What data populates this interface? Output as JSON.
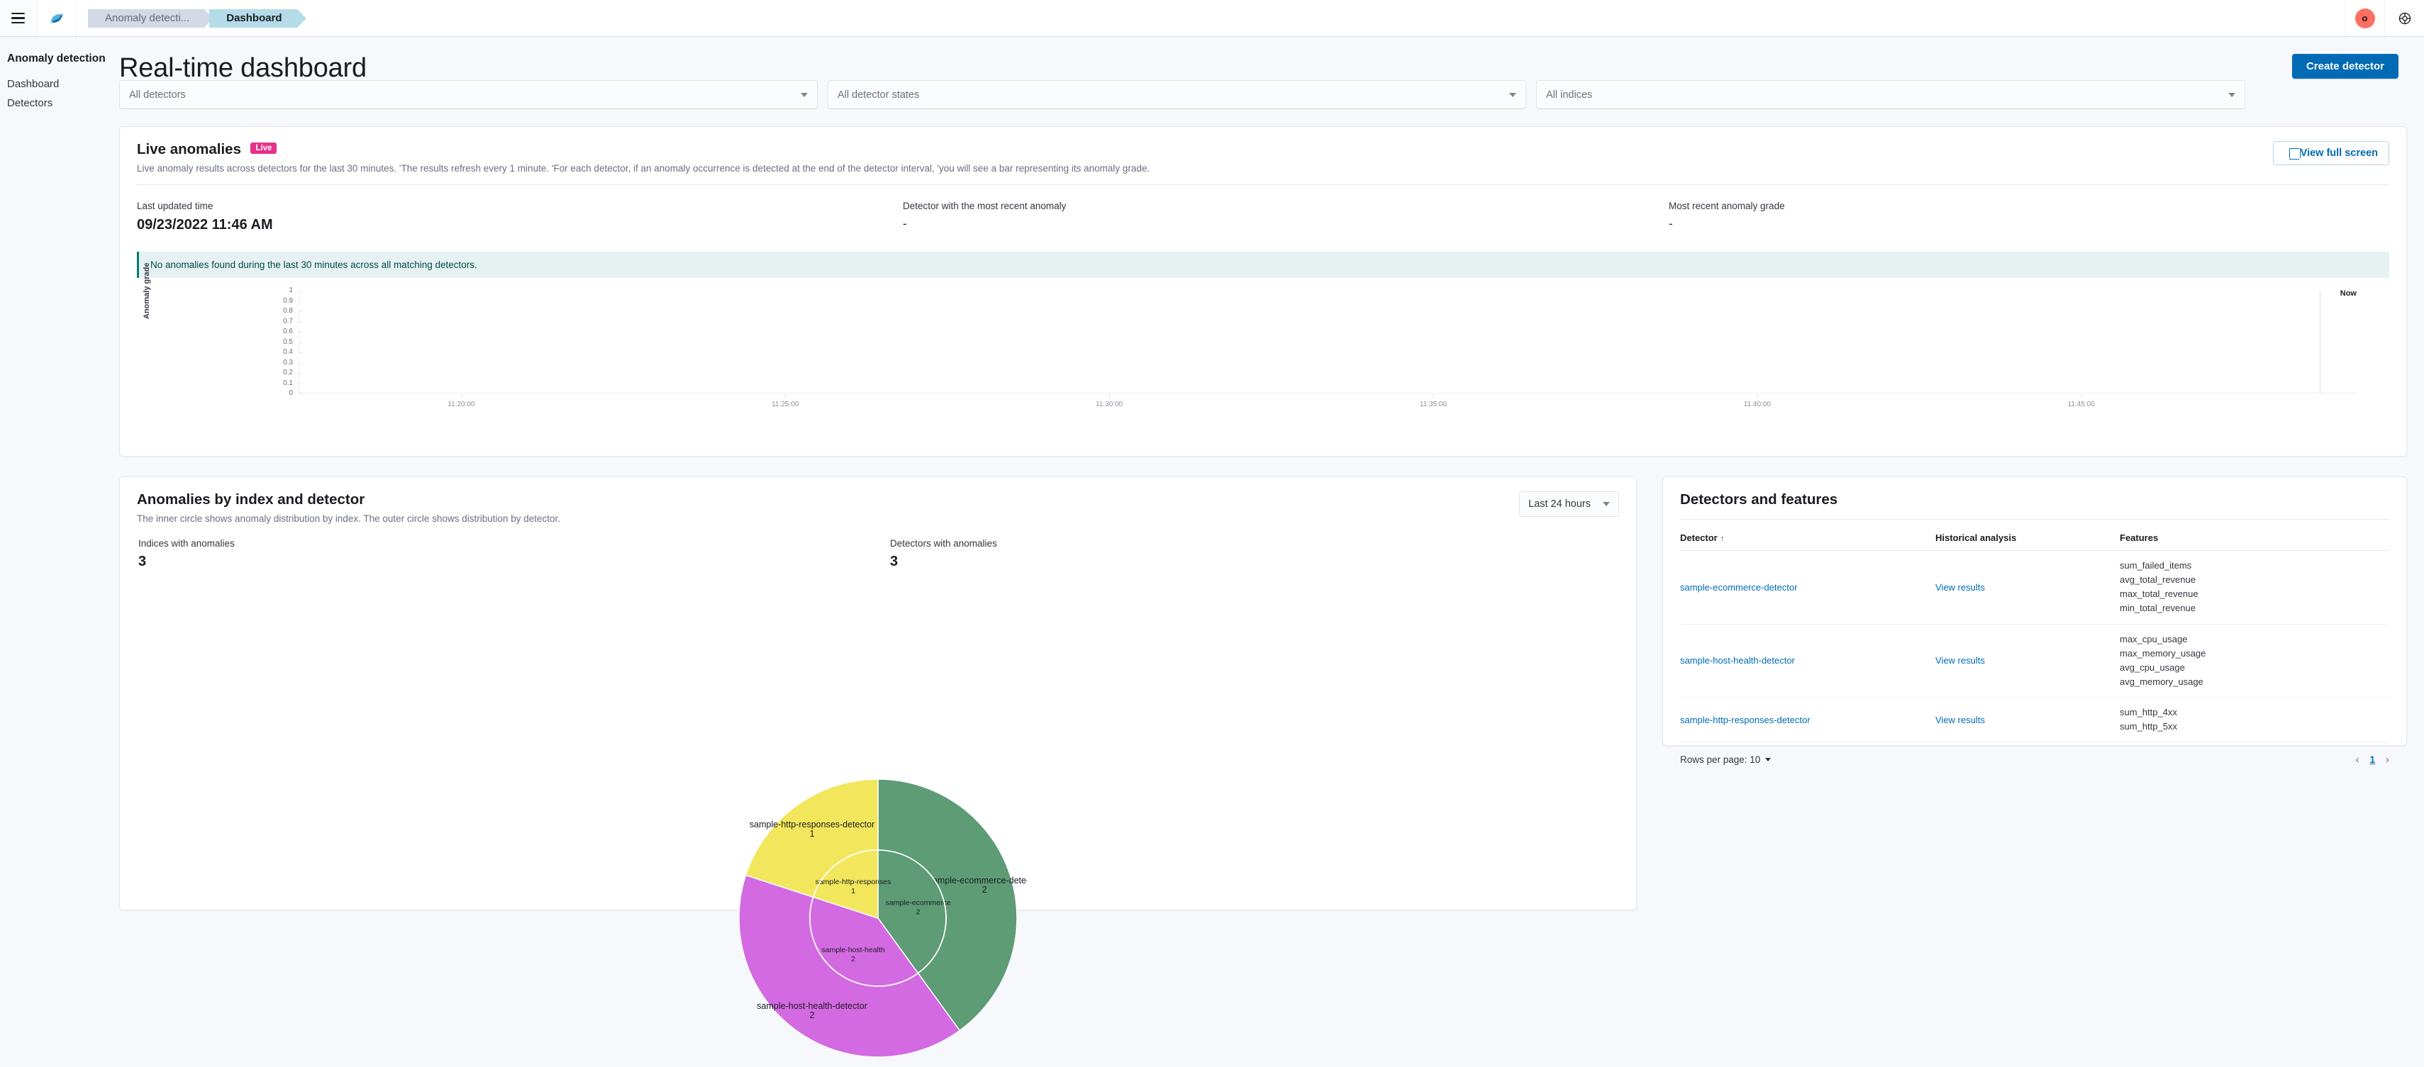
{
  "chrome": {
    "menu_icon": "hamburger-icon",
    "logo_icon": "opensearch-logo-icon",
    "breadcrumbs": [
      {
        "label": "Anomaly detecti...",
        "active": false
      },
      {
        "label": "Dashboard",
        "active": true
      }
    ],
    "avatar_initial": "o",
    "help_icon": "help-icon",
    "accent": "#006bb4"
  },
  "sidebar": {
    "title": "Anomaly detection",
    "items": [
      {
        "label": "Dashboard"
      },
      {
        "label": "Detectors"
      }
    ]
  },
  "header": {
    "title": "Real-time dashboard",
    "create_button": "Create detector"
  },
  "filters": [
    {
      "name": "detectors",
      "value": "All detectors"
    },
    {
      "name": "detector-states",
      "value": "All detector states"
    },
    {
      "name": "indices",
      "value": "All indices"
    }
  ],
  "live": {
    "title": "Live anomalies",
    "badge": "Live",
    "badge_color": "#e7318a",
    "description": "Live anomaly results across detectors for the last 30 minutes. 'The results refresh every 1 minute. 'For each detector, if an anomaly occurrence is detected at the end of the detector interval, 'you will see a bar representing its anomaly grade.",
    "fullscreen_button": "View full screen",
    "stats": [
      {
        "label": "Last updated time",
        "value": "09/23/2022 11:46 AM",
        "dash": false
      },
      {
        "label": "Detector with the most recent anomaly",
        "value": "-",
        "dash": true
      },
      {
        "label": "Most recent anomaly grade",
        "value": "-",
        "dash": true
      }
    ],
    "callout": "No anomalies found during the last 30 minutes across all matching detectors.",
    "chart_data": {
      "type": "bar",
      "title": "Live anomalies",
      "xlabel": "",
      "ylabel": "Anomaly grade",
      "ylim": [
        0,
        1
      ],
      "yticks": [
        "1",
        "0.9",
        "0.8",
        "0.7",
        "0.6",
        "0.5",
        "0.4",
        "0.3",
        "0.2",
        "0.1",
        "0"
      ],
      "xticks": [
        "11:20:00",
        "11:25:00",
        "11:30:00",
        "11:35:00",
        "11:40:00",
        "11:45:00"
      ],
      "now_label": "Now",
      "categories": [],
      "values": [],
      "grid": false,
      "legend": "none"
    }
  },
  "pie_panel": {
    "title": "Anomalies by index and detector",
    "description": "The inner circle shows anomaly distribution by index. The outer circle shows distribution by detector.",
    "time_range": "Last 24 hours",
    "stats": [
      {
        "label": "Indices with anomalies",
        "value": "3"
      },
      {
        "label": "Detectors with anomalies",
        "value": "3"
      }
    ],
    "chart_data": {
      "type": "pie",
      "title": "Anomalies by index and detector",
      "subtitle": "The inner circle shows anomaly distribution by index. The outer circle shows distribution by detector.",
      "legend": "none",
      "rings": [
        {
          "name": "inner",
          "description": "anomaly distribution by index",
          "slices": [
            {
              "label": "sample-ecommerce",
              "value": 2,
              "color": "#5e9c76"
            },
            {
              "label": "sample-host-health",
              "value": 2,
              "color": "#d36ae2"
            },
            {
              "label": "sample-http-responses",
              "value": 1,
              "color": "#f2e75c"
            }
          ]
        },
        {
          "name": "outer",
          "description": "distribution by detector",
          "slices": [
            {
              "label": "sample-ecommerce-detector",
              "value": 2,
              "color": "#5e9c76"
            },
            {
              "label": "sample-host-health-detector",
              "value": 2,
              "color": "#d36ae2"
            },
            {
              "label": "sample-http-responses-detector",
              "value": 1,
              "color": "#f2e75c"
            }
          ]
        }
      ],
      "total": 5
    }
  },
  "detectors_panel": {
    "title": "Detectors and features",
    "columns": [
      "Detector",
      "Historical analysis",
      "Features"
    ],
    "sort_column": "Detector",
    "sort_direction": "asc",
    "rows": [
      {
        "detector": "sample-ecommerce-detector",
        "historical": "View results",
        "features": [
          "sum_failed_items",
          "avg_total_revenue",
          "max_total_revenue",
          "min_total_revenue"
        ]
      },
      {
        "detector": "sample-host-health-detector",
        "historical": "View results",
        "features": [
          "max_cpu_usage",
          "max_memory_usage",
          "avg_cpu_usage",
          "avg_memory_usage"
        ]
      },
      {
        "detector": "sample-http-responses-detector",
        "historical": "View results",
        "features": [
          "sum_http_4xx",
          "sum_http_5xx"
        ]
      }
    ],
    "rows_per_page_label": "Rows per page: 10",
    "page_prev": "‹",
    "page_current": "1",
    "page_next": "›"
  }
}
